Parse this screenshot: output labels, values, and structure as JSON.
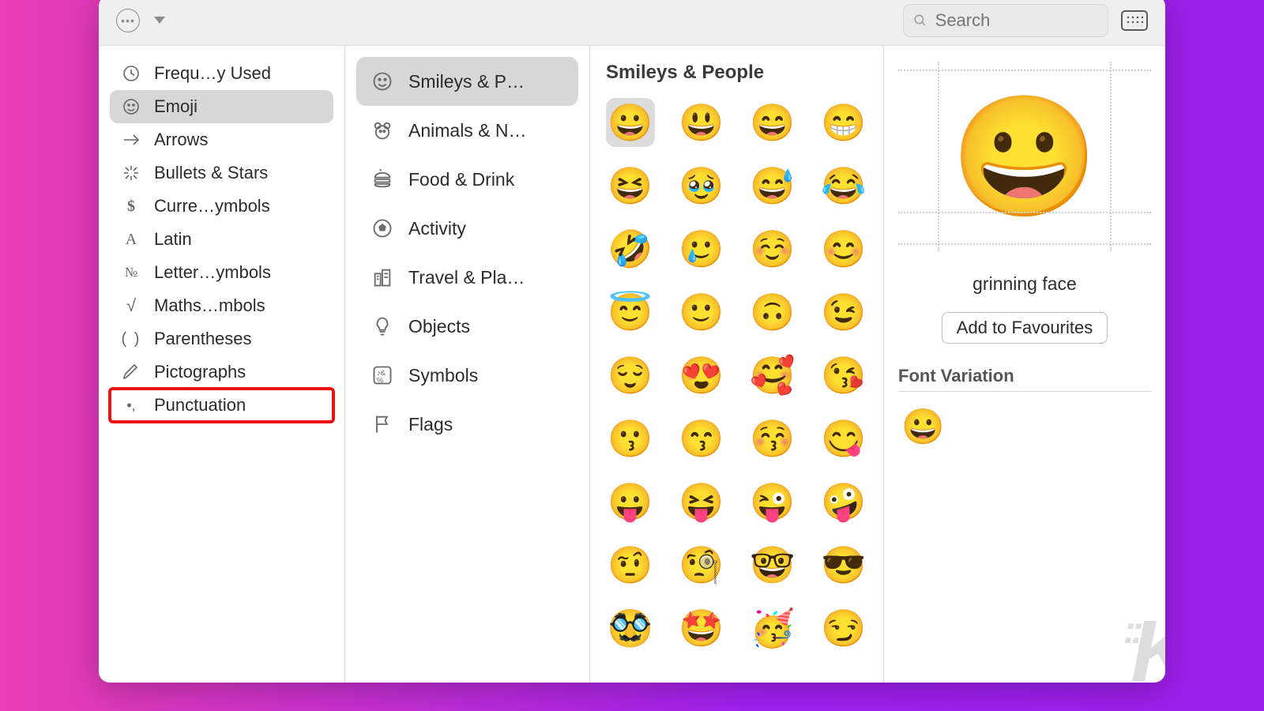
{
  "toolbar": {
    "search_placeholder": "Search"
  },
  "categories": [
    {
      "id": "frequently-used",
      "label": "Frequ…y Used",
      "icon": "clock"
    },
    {
      "id": "emoji",
      "label": "Emoji",
      "icon": "smiley",
      "selected": true
    },
    {
      "id": "arrows",
      "label": "Arrows",
      "icon": "arrow-right"
    },
    {
      "id": "bullets-stars",
      "label": "Bullets & Stars",
      "icon": "burst"
    },
    {
      "id": "currency",
      "label": "Curre…ymbols",
      "icon": "dollar"
    },
    {
      "id": "latin",
      "label": "Latin",
      "icon": "serif-a"
    },
    {
      "id": "letterlike",
      "label": "Letter…ymbols",
      "icon": "numero"
    },
    {
      "id": "maths",
      "label": "Maths…mbols",
      "icon": "radical"
    },
    {
      "id": "parentheses",
      "label": "Parentheses",
      "icon": "parens"
    },
    {
      "id": "pictographs",
      "label": "Pictographs",
      "icon": "hand-write"
    },
    {
      "id": "punctuation",
      "label": "Punctuation",
      "icon": "punct",
      "highlighted": true
    }
  ],
  "subcategories": [
    {
      "id": "smileys-people",
      "label": "Smileys & P…",
      "icon": "smiley",
      "selected": true
    },
    {
      "id": "animals-nature",
      "label": "Animals & N…",
      "icon": "bear"
    },
    {
      "id": "food-drink",
      "label": "Food & Drink",
      "icon": "burger"
    },
    {
      "id": "activity",
      "label": "Activity",
      "icon": "soccer"
    },
    {
      "id": "travel-places",
      "label": "Travel & Pla…",
      "icon": "city"
    },
    {
      "id": "objects",
      "label": "Objects",
      "icon": "bulb"
    },
    {
      "id": "symbols",
      "label": "Symbols",
      "icon": "symbols"
    },
    {
      "id": "flags",
      "label": "Flags",
      "icon": "flag"
    }
  ],
  "grid": {
    "title": "Smileys & People",
    "emojis": [
      "😀",
      "😃",
      "😄",
      "😁",
      "😆",
      "🥹",
      "😅",
      "😂",
      "🤣",
      "🥲",
      "☺️",
      "😊",
      "😇",
      "🙂",
      "🙃",
      "😉",
      "😌",
      "😍",
      "🥰",
      "😘",
      "😗",
      "😙",
      "😚",
      "😋",
      "😛",
      "😝",
      "😜",
      "🤪",
      "🤨",
      "🧐",
      "🤓",
      "😎",
      "🥸",
      "🤩",
      "🥳",
      "😏"
    ],
    "selected_index": 0
  },
  "preview": {
    "emoji": "😀",
    "name": "grinning face",
    "favorite_button": "Add to Favourites",
    "font_variation_title": "Font Variation",
    "font_variation_emoji": "😀"
  }
}
